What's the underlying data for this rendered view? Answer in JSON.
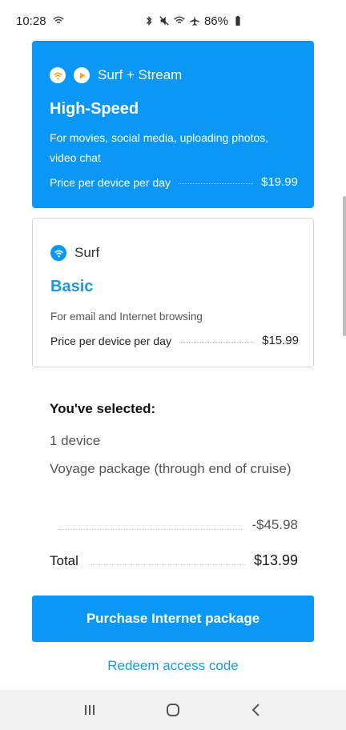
{
  "status_bar": {
    "time": "10:28",
    "battery": "86%"
  },
  "packages": [
    {
      "name": "Surf + Stream",
      "tier": "High-Speed",
      "description": "For movies, social media, uploading photos, video chat",
      "price_label": "Price per device per day",
      "price": "$19.99",
      "selected": true
    },
    {
      "name": "Surf",
      "tier": "Basic",
      "description": "For email and Internet browsing",
      "price_label": "Price per device per day",
      "price": "$15.99",
      "selected": false
    }
  ],
  "summary": {
    "heading": "You've selected:",
    "devices": "1 device",
    "package": "Voyage package (through end of cruise)",
    "discount": "-$45.98",
    "total_label": "Total",
    "total": "$13.99"
  },
  "actions": {
    "purchase": "Purchase Internet package",
    "redeem": "Redeem access code"
  },
  "colors": {
    "accent": "#0a97f5",
    "link": "#1a9ad9"
  },
  "icons": [
    "wifi-icon",
    "play-icon",
    "bluetooth-icon",
    "mute-icon",
    "airplane-icon",
    "battery-icon",
    "recent-apps-icon",
    "home-icon",
    "back-icon"
  ]
}
